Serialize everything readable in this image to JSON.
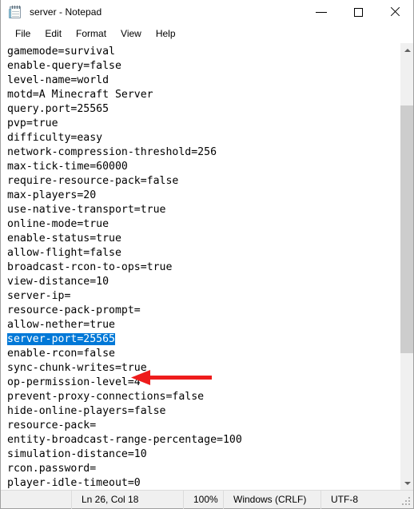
{
  "window": {
    "title": "server - Notepad",
    "app_icon": "notepad-icon"
  },
  "titlebar": {
    "minimize_label": "minimize-icon",
    "maximize_label": "maximize-icon",
    "close_label": "close-icon"
  },
  "menubar": {
    "items": [
      {
        "label": "File"
      },
      {
        "label": "Edit"
      },
      {
        "label": "Format"
      },
      {
        "label": "View"
      },
      {
        "label": "Help"
      }
    ]
  },
  "editor": {
    "lines": [
      {
        "text": "gamemode=survival",
        "selected": false
      },
      {
        "text": "enable-query=false",
        "selected": false
      },
      {
        "text": "level-name=world",
        "selected": false
      },
      {
        "text": "motd=A Minecraft Server",
        "selected": false
      },
      {
        "text": "query.port=25565",
        "selected": false
      },
      {
        "text": "pvp=true",
        "selected": false
      },
      {
        "text": "difficulty=easy",
        "selected": false
      },
      {
        "text": "network-compression-threshold=256",
        "selected": false
      },
      {
        "text": "max-tick-time=60000",
        "selected": false
      },
      {
        "text": "require-resource-pack=false",
        "selected": false
      },
      {
        "text": "max-players=20",
        "selected": false
      },
      {
        "text": "use-native-transport=true",
        "selected": false
      },
      {
        "text": "online-mode=true",
        "selected": false
      },
      {
        "text": "enable-status=true",
        "selected": false
      },
      {
        "text": "allow-flight=false",
        "selected": false
      },
      {
        "text": "broadcast-rcon-to-ops=true",
        "selected": false
      },
      {
        "text": "view-distance=10",
        "selected": false
      },
      {
        "text": "server-ip=",
        "selected": false
      },
      {
        "text": "resource-pack-prompt=",
        "selected": false
      },
      {
        "text": "allow-nether=true",
        "selected": false
      },
      {
        "text": "server-port=25565",
        "selected": true
      },
      {
        "text": "enable-rcon=false",
        "selected": false
      },
      {
        "text": "sync-chunk-writes=true",
        "selected": false
      },
      {
        "text": "op-permission-level=4",
        "selected": false
      },
      {
        "text": "prevent-proxy-connections=false",
        "selected": false
      },
      {
        "text": "hide-online-players=false",
        "selected": false
      },
      {
        "text": "resource-pack=",
        "selected": false
      },
      {
        "text": "entity-broadcast-range-percentage=100",
        "selected": false
      },
      {
        "text": "simulation-distance=10",
        "selected": false
      },
      {
        "text": "rcon.password=",
        "selected": false
      },
      {
        "text": "player-idle-timeout=0",
        "selected": false
      }
    ],
    "selection_color": "#0078d7",
    "selection_text_color": "#ffffff"
  },
  "annotation": {
    "type": "left-arrow",
    "color": "#ee1c1c",
    "points_to": "server-port=25565"
  },
  "scrollbar": {
    "up_arrow": "chevron-up-icon",
    "down_arrow": "chevron-down-icon",
    "thumb_color": "#cdcdcd"
  },
  "statusbar": {
    "cursor_position": "Ln 26, Col 18",
    "zoom": "100%",
    "line_ending": "Windows (CRLF)",
    "encoding": "UTF-8"
  }
}
